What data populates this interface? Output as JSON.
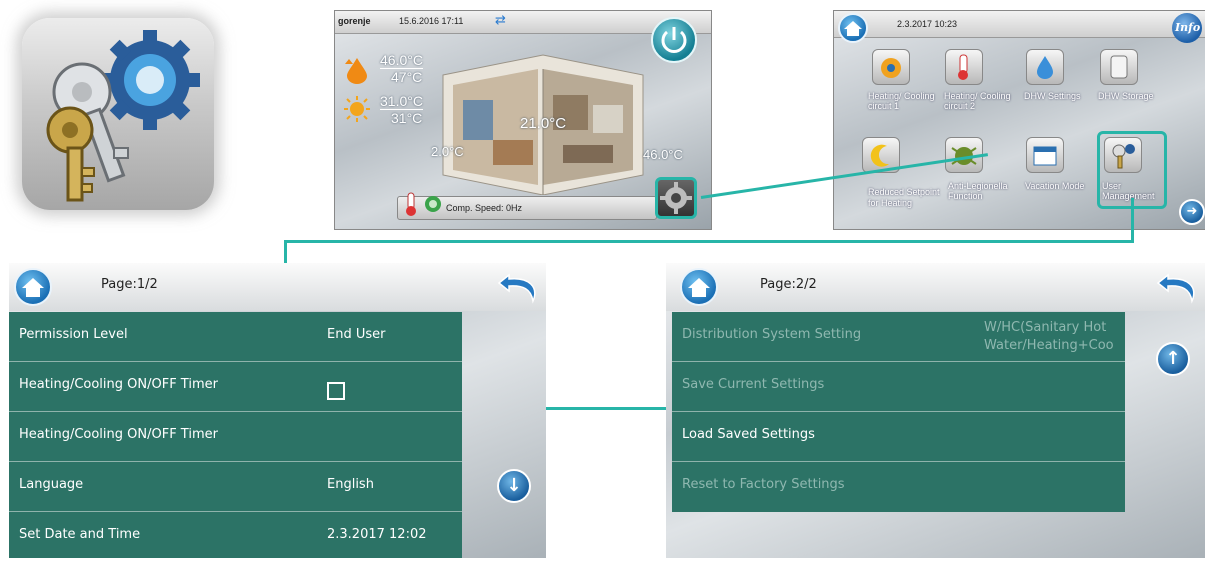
{
  "colors": {
    "accent": "#27b5a8",
    "panel_green": "#2c7366",
    "home_blue": "#1a6fb5"
  },
  "icons": [
    "keys-gear-icon",
    "power-icon",
    "settings-gear-icon",
    "home-icon",
    "info-icon",
    "arrow-right-icon",
    "back-arrow-icon",
    "arrow-down-icon",
    "arrow-up-icon"
  ],
  "screen1": {
    "brand": "gorenje",
    "datetime": "15.6.2016 17:11",
    "dhw_set": "46.0°C",
    "dhw_actual": "47°C",
    "outdoor_set": "31.0°C",
    "outdoor_actual": "31°C",
    "left_temp": "2.0°C",
    "room_temp": "21.0°C",
    "right_temp": "46.0°C",
    "comp_speed": "Comp. Speed: 0Hz"
  },
  "screen2": {
    "datetime": "2.3.2017 10:23",
    "info_label": "Info",
    "tiles": [
      {
        "label": "Heating/ Cooling circuit 1"
      },
      {
        "label": "Heating/ Cooling circuit 2"
      },
      {
        "label": "DHW Settings"
      },
      {
        "label": "DHW Storage"
      },
      {
        "label": "Reduced Setpoint for Heating"
      },
      {
        "label": "Anti-Legionella Function"
      },
      {
        "label": "Vacation Mode"
      },
      {
        "label": "User Management"
      }
    ]
  },
  "page1": {
    "page_label": "Page:1/2",
    "rows": [
      {
        "label": "Permission Level",
        "value": "End User"
      },
      {
        "label": "Heating/Cooling ON/OFF Timer",
        "value": ""
      },
      {
        "label": "Heating/Cooling ON/OFF Timer",
        "value": ""
      },
      {
        "label": "Language",
        "value": "English"
      },
      {
        "label": "Set Date and Time",
        "value": "2.3.2017 12:02"
      }
    ]
  },
  "page2": {
    "page_label": "Page:2/2",
    "rows": [
      {
        "label": "Distribution System Setting",
        "value_line1": "W/HC(Sanitary Hot",
        "value_line2": "Water/Heating+Coo"
      },
      {
        "label": "Save Current Settings"
      },
      {
        "label": "Load Saved Settings"
      },
      {
        "label": "Reset to Factory Settings"
      }
    ]
  }
}
